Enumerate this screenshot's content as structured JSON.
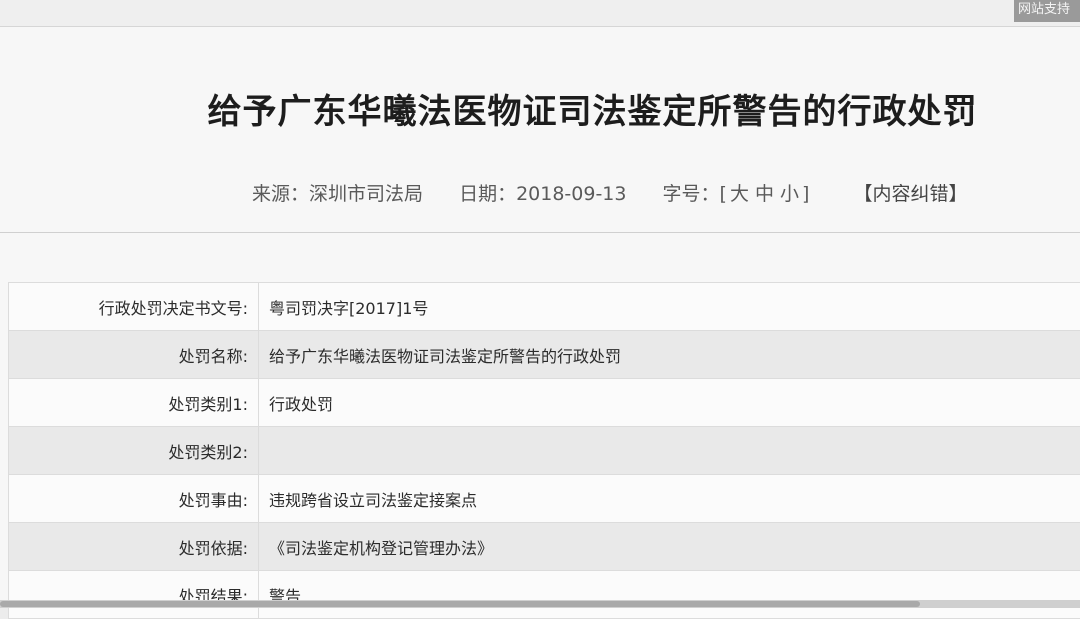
{
  "header": {
    "support_tab": "网站支持"
  },
  "article": {
    "title": "给予广东华曦法医物证司法鉴定所警告的行政处罚",
    "meta": {
      "source": "来源：深圳市司法局",
      "date": "日期：2018-09-13",
      "font_size_label": "字号：[",
      "size_large": "大",
      "size_medium": "中",
      "size_small": "小",
      "font_size_close": "]",
      "correction": "【内容纠错】"
    }
  },
  "table": {
    "rows": [
      {
        "label": "行政处罚决定书文号:",
        "value": "粤司罚决字[2017]1号"
      },
      {
        "label": "处罚名称:",
        "value": "给予广东华曦法医物证司法鉴定所警告的行政处罚"
      },
      {
        "label": "处罚类别1:",
        "value": "行政处罚"
      },
      {
        "label": "处罚类别2:",
        "value": ""
      },
      {
        "label": "处罚事由:",
        "value": "违规跨省设立司法鉴定接案点"
      },
      {
        "label": "处罚依据:",
        "value": "《司法鉴定机构登记管理办法》"
      },
      {
        "label": "处罚结果:",
        "value": "警告"
      }
    ]
  },
  "colors": {
    "page_bg": "#f7f7f7",
    "row_alt": "#e9e9e9",
    "support_tab": "#9a9a9a"
  }
}
